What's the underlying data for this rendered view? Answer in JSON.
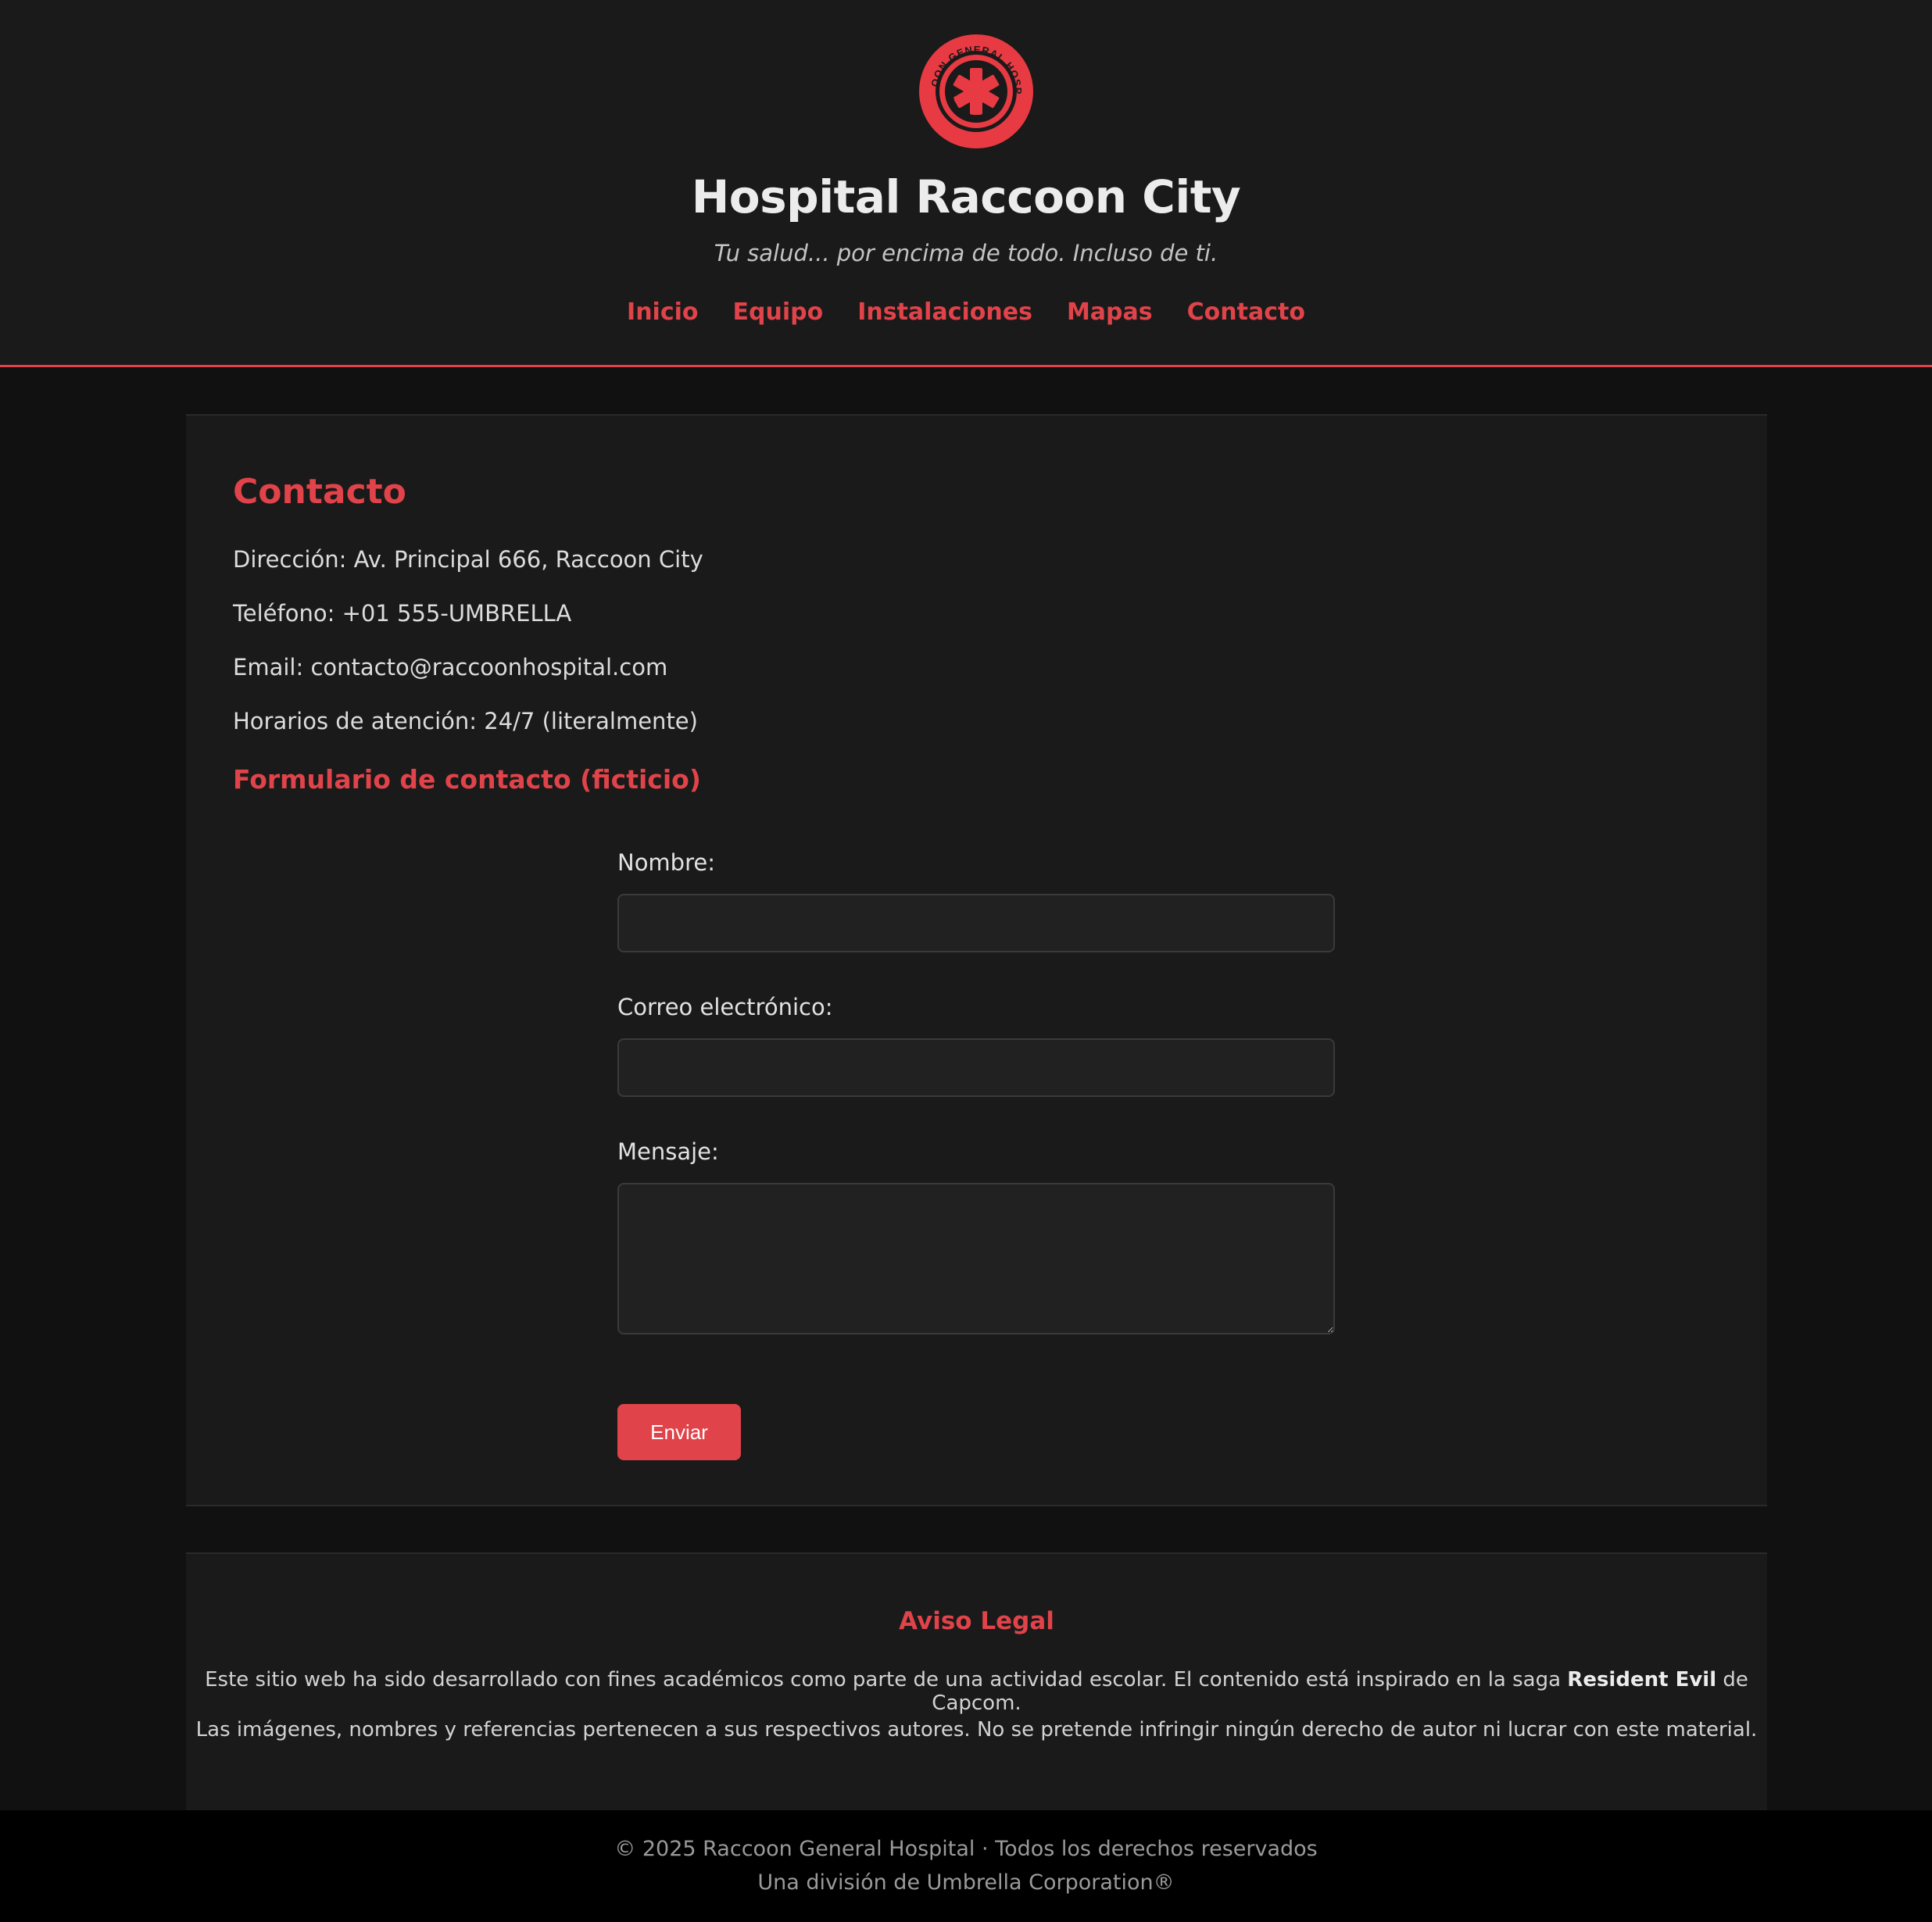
{
  "brand": {
    "logo_text_top": "RACCOON GENERAL HOSPITAL",
    "logo_text_bottom": "RACCOON CITY",
    "title": "Hospital Raccoon City",
    "tagline": "Tu salud... por encima de todo. Incluso de ti.",
    "accent_color": "#e04349"
  },
  "nav": {
    "items": [
      {
        "label": "Inicio"
      },
      {
        "label": "Equipo"
      },
      {
        "label": "Instalaciones"
      },
      {
        "label": "Mapas"
      },
      {
        "label": "Contacto"
      }
    ]
  },
  "contact": {
    "title": "Contacto",
    "address": "Dirección: Av. Principal 666, Raccoon City",
    "phone": "Teléfono: +01 555-UMBRELLA",
    "email": "Email: contacto@raccoonhospital.com",
    "hours": "Horarios de atención: 24/7 (literalmente)"
  },
  "form": {
    "title": "Formulario de contacto (ficticio)",
    "name_label": "Nombre:",
    "name_value": "",
    "email_label": "Correo electrónico:",
    "email_value": "",
    "message_label": "Mensaje:",
    "message_value": "",
    "submit_label": "Enviar"
  },
  "legal": {
    "title": "Aviso Legal",
    "line1_before": "Este sitio web ha sido desarrollado con fines académicos como parte de una actividad escolar. El contenido está inspirado en la saga ",
    "line1_bold": "Resident Evil",
    "line1_after": " de Capcom.",
    "line2": "Las imágenes, nombres y referencias pertenecen a sus respectivos autores. No se pretende infringir ningún derecho de autor ni lucrar con este material."
  },
  "footer": {
    "copyright": "© 2025 Raccoon General Hospital · Todos los derechos reservados",
    "division": "Una división de Umbrella Corporation®"
  }
}
